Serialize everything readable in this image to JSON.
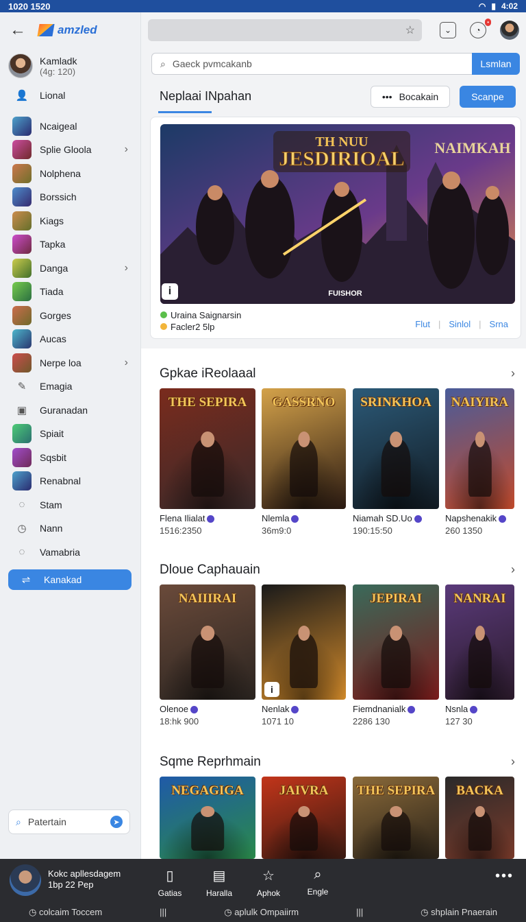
{
  "status": {
    "left": "1020 1520",
    "right": "4:02"
  },
  "sidebar": {
    "brand": "amzled",
    "profile": {
      "name": "Kamladk",
      "sub": "(4g: 120)"
    },
    "items": [
      {
        "label": "Lional",
        "icon": "person-icon"
      },
      {
        "label": "Ncaigeal",
        "icon": "game-icon"
      },
      {
        "label": "Splie Gloola",
        "icon": "game-icon",
        "chevron": true
      },
      {
        "label": "Nolphena",
        "icon": "game-icon"
      },
      {
        "label": "Borssich",
        "icon": "game-icon"
      },
      {
        "label": "Kiags",
        "icon": "game-icon"
      },
      {
        "label": "Tapka",
        "icon": "game-icon"
      },
      {
        "label": "Danga",
        "icon": "game-icon",
        "chevron": true
      },
      {
        "label": "Tiada",
        "icon": "game-icon"
      },
      {
        "label": "Gorges",
        "icon": "game-icon"
      },
      {
        "label": "Aucas",
        "icon": "game-icon"
      },
      {
        "label": "Nerpe loa",
        "icon": "game-icon",
        "chevron": true
      },
      {
        "label": "Emagia",
        "icon": "pen-icon"
      },
      {
        "label": "Guranadan",
        "icon": "bookmark-icon"
      },
      {
        "label": "Spiait",
        "icon": "game-icon"
      },
      {
        "label": "Sqsbit",
        "icon": "game-icon"
      },
      {
        "label": "Renabnal",
        "icon": "game-icon"
      },
      {
        "label": "Stam",
        "icon": "circle-icon"
      },
      {
        "label": "Nann",
        "icon": "clock-icon"
      },
      {
        "label": "Vamabria",
        "icon": "circle-icon"
      }
    ],
    "active": "Kanakad",
    "search_label": "Patertain"
  },
  "top": {
    "search_placeholder": "Gaeck pvmcakanb",
    "search_button": "Lsmlan"
  },
  "page": {
    "title": "Neplaai INpahan",
    "btn_out": "Bocakain",
    "btn_blue": "Scanpe"
  },
  "hero": {
    "title": "TH NUU JESDIRIOAL",
    "right_logo": "NAIMKAH",
    "tag": "FUISHOR",
    "meta1": "Uraina Saignarsin",
    "meta2": "Facler2 5lp",
    "links": [
      "Flut",
      "Sinlol",
      "Srna"
    ]
  },
  "sections": [
    {
      "title": "Gpkae iReolaaal",
      "cards": [
        {
          "art": "THE SEPIRA",
          "name": "Flena Ilialat",
          "sub": "1516:2350",
          "tone": [
            "#7a2b1d",
            "#3a2a2a"
          ]
        },
        {
          "art": "GASSRNO",
          "name": "Nlemla",
          "sub": "36m9:0",
          "tone": [
            "#d4a24a",
            "#2b1a12"
          ]
        },
        {
          "art": "SRINKHOA",
          "name": "Niamah SD.Uo",
          "sub": "190:15:50",
          "tone": [
            "#2c5a78",
            "#111a22"
          ]
        },
        {
          "art": "NAIYIRA",
          "name": "Napshenakik",
          "sub": "260 1350",
          "tone": [
            "#4a5c9a",
            "#c24a2b"
          ]
        }
      ]
    },
    {
      "title": "Dloue Caphauain",
      "cards": [
        {
          "art": "NAIIIRAI",
          "name": "Olenoe",
          "sub": "18:hk 900",
          "tone": [
            "#6a4a3a",
            "#2a2420"
          ]
        },
        {
          "art": "",
          "name": "Nenlak",
          "sub": "1071 10",
          "tone": [
            "#1a1a1a",
            "#d28a2a"
          ]
        },
        {
          "art": "JEPIRAI",
          "name": "Fiemdnanialk",
          "sub": "2286 130",
          "tone": [
            "#3a6a5a",
            "#7a1a1a"
          ]
        },
        {
          "art": "NANRAI",
          "name": "Nsnla",
          "sub": "127 30",
          "tone": [
            "#5a3a7a",
            "#2a1a2a"
          ]
        }
      ]
    },
    {
      "title": "Sqme Reprhmain",
      "cards": [
        {
          "art": "NEGAGIGA",
          "name": "",
          "sub": "",
          "tone": [
            "#1f5aa8",
            "#2a8a4a"
          ]
        },
        {
          "art": "JAIVRA",
          "name": "",
          "sub": "",
          "tone": [
            "#c2351a",
            "#3a1a12"
          ]
        },
        {
          "art": "THE SEPIRA",
          "name": "",
          "sub": "",
          "tone": [
            "#8a6a3a",
            "#2a2218"
          ]
        },
        {
          "art": "BACKA",
          "name": "",
          "sub": "",
          "tone": [
            "#2a2a2a",
            "#7a3a2a"
          ]
        }
      ]
    }
  ],
  "bottom": {
    "now_title": "Kokc apllesdagem",
    "now_sub": "1bp 22 Pep",
    "nav": [
      "Gatias",
      "Haralla",
      "Aphok",
      "Engle"
    ],
    "bottom_links": [
      "colcaim Toccem",
      "aplulk Ompaiirm",
      "shplain Pnaerain"
    ]
  },
  "colors": {
    "accent": "#3a86e2",
    "statusbar": "#1f4f9e",
    "bottombar": "#2b2c30"
  }
}
